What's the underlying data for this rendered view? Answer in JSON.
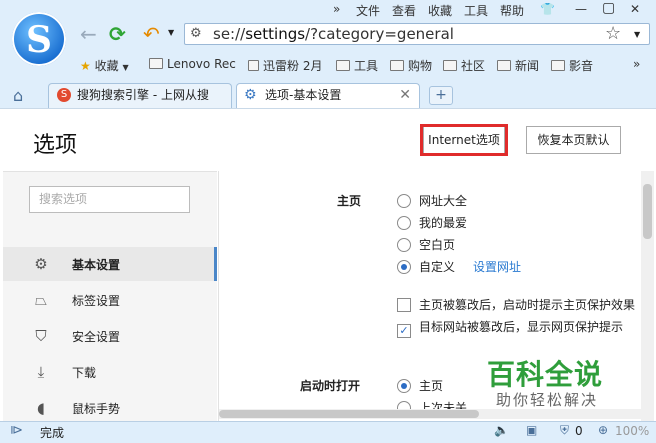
{
  "menubar": {
    "items": [
      "文件",
      "查看",
      "收藏",
      "工具",
      "帮助"
    ]
  },
  "address": {
    "scheme": "se://",
    "host": "settings",
    "path": "/?category=general"
  },
  "bookmarks": [
    {
      "label": "收藏",
      "icon": "star-icon"
    },
    {
      "label": "Lenovo Rec",
      "icon": "folder-icon"
    },
    {
      "label": "迅雷粉 2月",
      "icon": "page-icon"
    },
    {
      "label": "工具",
      "icon": "folder-icon"
    },
    {
      "label": "购物",
      "icon": "folder-icon"
    },
    {
      "label": "社区",
      "icon": "folder-icon"
    },
    {
      "label": "新闻",
      "icon": "folder-icon"
    },
    {
      "label": "影音",
      "icon": "folder-icon"
    }
  ],
  "tabs": [
    {
      "label": "搜狗搜索引擎 - 上网从搜"
    },
    {
      "label": "选项-基本设置"
    }
  ],
  "page": {
    "title": "选项",
    "internet_button": "Internet选项",
    "restore_button": "恢复本页默认",
    "search_placeholder": "搜索选项"
  },
  "sidebar": {
    "items": [
      {
        "label": "基本设置",
        "icon": "gear-icon"
      },
      {
        "label": "标签设置",
        "icon": "tab-icon"
      },
      {
        "label": "安全设置",
        "icon": "shield-icon"
      },
      {
        "label": "下载",
        "icon": "download-icon"
      },
      {
        "label": "鼠标手势",
        "icon": "mouse-icon"
      }
    ]
  },
  "homepage": {
    "label": "主页",
    "options": [
      "网址大全",
      "我的最爱",
      "空白页",
      "自定义"
    ],
    "set_url_link": "设置网址",
    "check1": "主页被篡改后，启动时提示主页保护效果",
    "check2": "目标网站被篡改后，显示网页保护提示"
  },
  "startup": {
    "label": "启动时打开",
    "options": [
      "主页",
      "上次未关"
    ]
  },
  "watermark": {
    "title": "百科全说",
    "subtitle": "助你轻松解决"
  },
  "status": {
    "text": "完成",
    "count": "0",
    "zoom": "100%"
  },
  "colors": {
    "accent": "#2c6cc4",
    "highlight": "#e02b2b",
    "watermark": "#2f9e3b"
  }
}
